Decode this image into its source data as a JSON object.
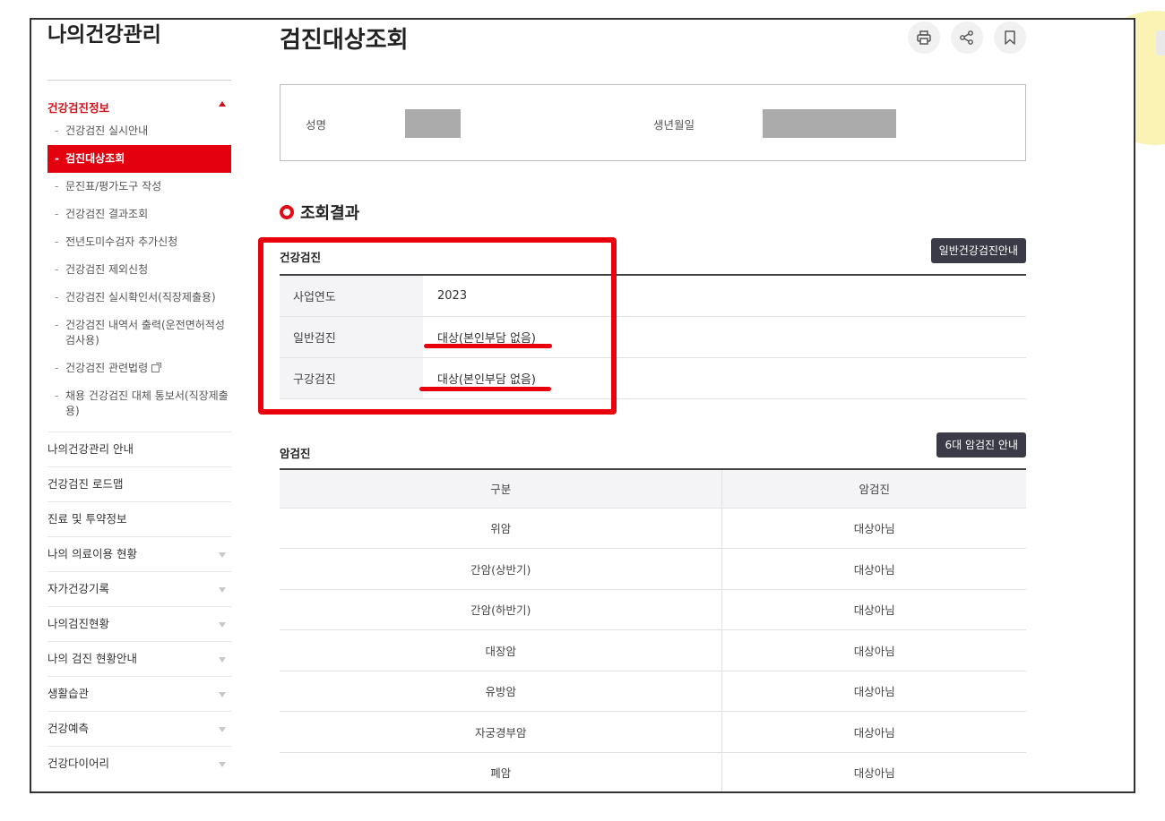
{
  "sidebar": {
    "title": "나의건강관리",
    "section": "건강검진정보",
    "sub_items": [
      {
        "label": "건강검진 실시안내"
      },
      {
        "label": "검진대상조회"
      },
      {
        "label": "문진표/평가도구 작성"
      },
      {
        "label": "건강검진 결과조회"
      },
      {
        "label": "전년도미수검자 추가신청"
      },
      {
        "label": "건강검진 제외신청"
      },
      {
        "label": "건강검진 실시확인서(직장제출용)"
      },
      {
        "label": "건강검진 내역서 출력(운전면허적성검사용)"
      },
      {
        "label": "건강검진 관련법령"
      },
      {
        "label": "채용 건강검진 대체 통보서(직장제출용)"
      }
    ],
    "menu_items": [
      {
        "label": "나의건강관리 안내"
      },
      {
        "label": "건강검진 로드맵"
      },
      {
        "label": "진료 및 투약정보"
      },
      {
        "label": "나의 의료이용 현황"
      },
      {
        "label": "자가건강기록"
      },
      {
        "label": "나의검진현황"
      },
      {
        "label": "나의 검진 현황안내"
      },
      {
        "label": "생활습관"
      },
      {
        "label": "건강예측"
      },
      {
        "label": "건강다이어리"
      }
    ]
  },
  "main": {
    "title": "검진대상조회",
    "tools": [
      "print-icon",
      "share-icon",
      "bookmark-icon"
    ],
    "info": {
      "name_label": "성명",
      "birth_label": "생년월일"
    },
    "result_title": "조회결과",
    "checkup": {
      "label": "건강검진",
      "guide_button": "일반건강검진안내",
      "rows": [
        {
          "key": "사업연도",
          "value": "2023"
        },
        {
          "key": "일반검진",
          "value": "대상(본인부담 없음)"
        },
        {
          "key": "구강검진",
          "value": "대상(본인부담 없음)"
        }
      ]
    },
    "cancer": {
      "label": "암검진",
      "guide_button": "6대 암검진 안내",
      "headers": [
        "구분",
        "암검진"
      ],
      "rows": [
        {
          "type": "위암",
          "status": "대상아님"
        },
        {
          "type": "간암(상반기)",
          "status": "대상아님"
        },
        {
          "type": "간암(하반기)",
          "status": "대상아님"
        },
        {
          "type": "대장암",
          "status": "대상아님"
        },
        {
          "type": "유방암",
          "status": "대상아님"
        },
        {
          "type": "자궁경부암",
          "status": "대상아님"
        },
        {
          "type": "폐암",
          "status": "대상아님"
        }
      ]
    }
  },
  "colors": {
    "accent": "#e3000f",
    "dark_button": "#3b3b47",
    "annotation": "#e8000d"
  }
}
